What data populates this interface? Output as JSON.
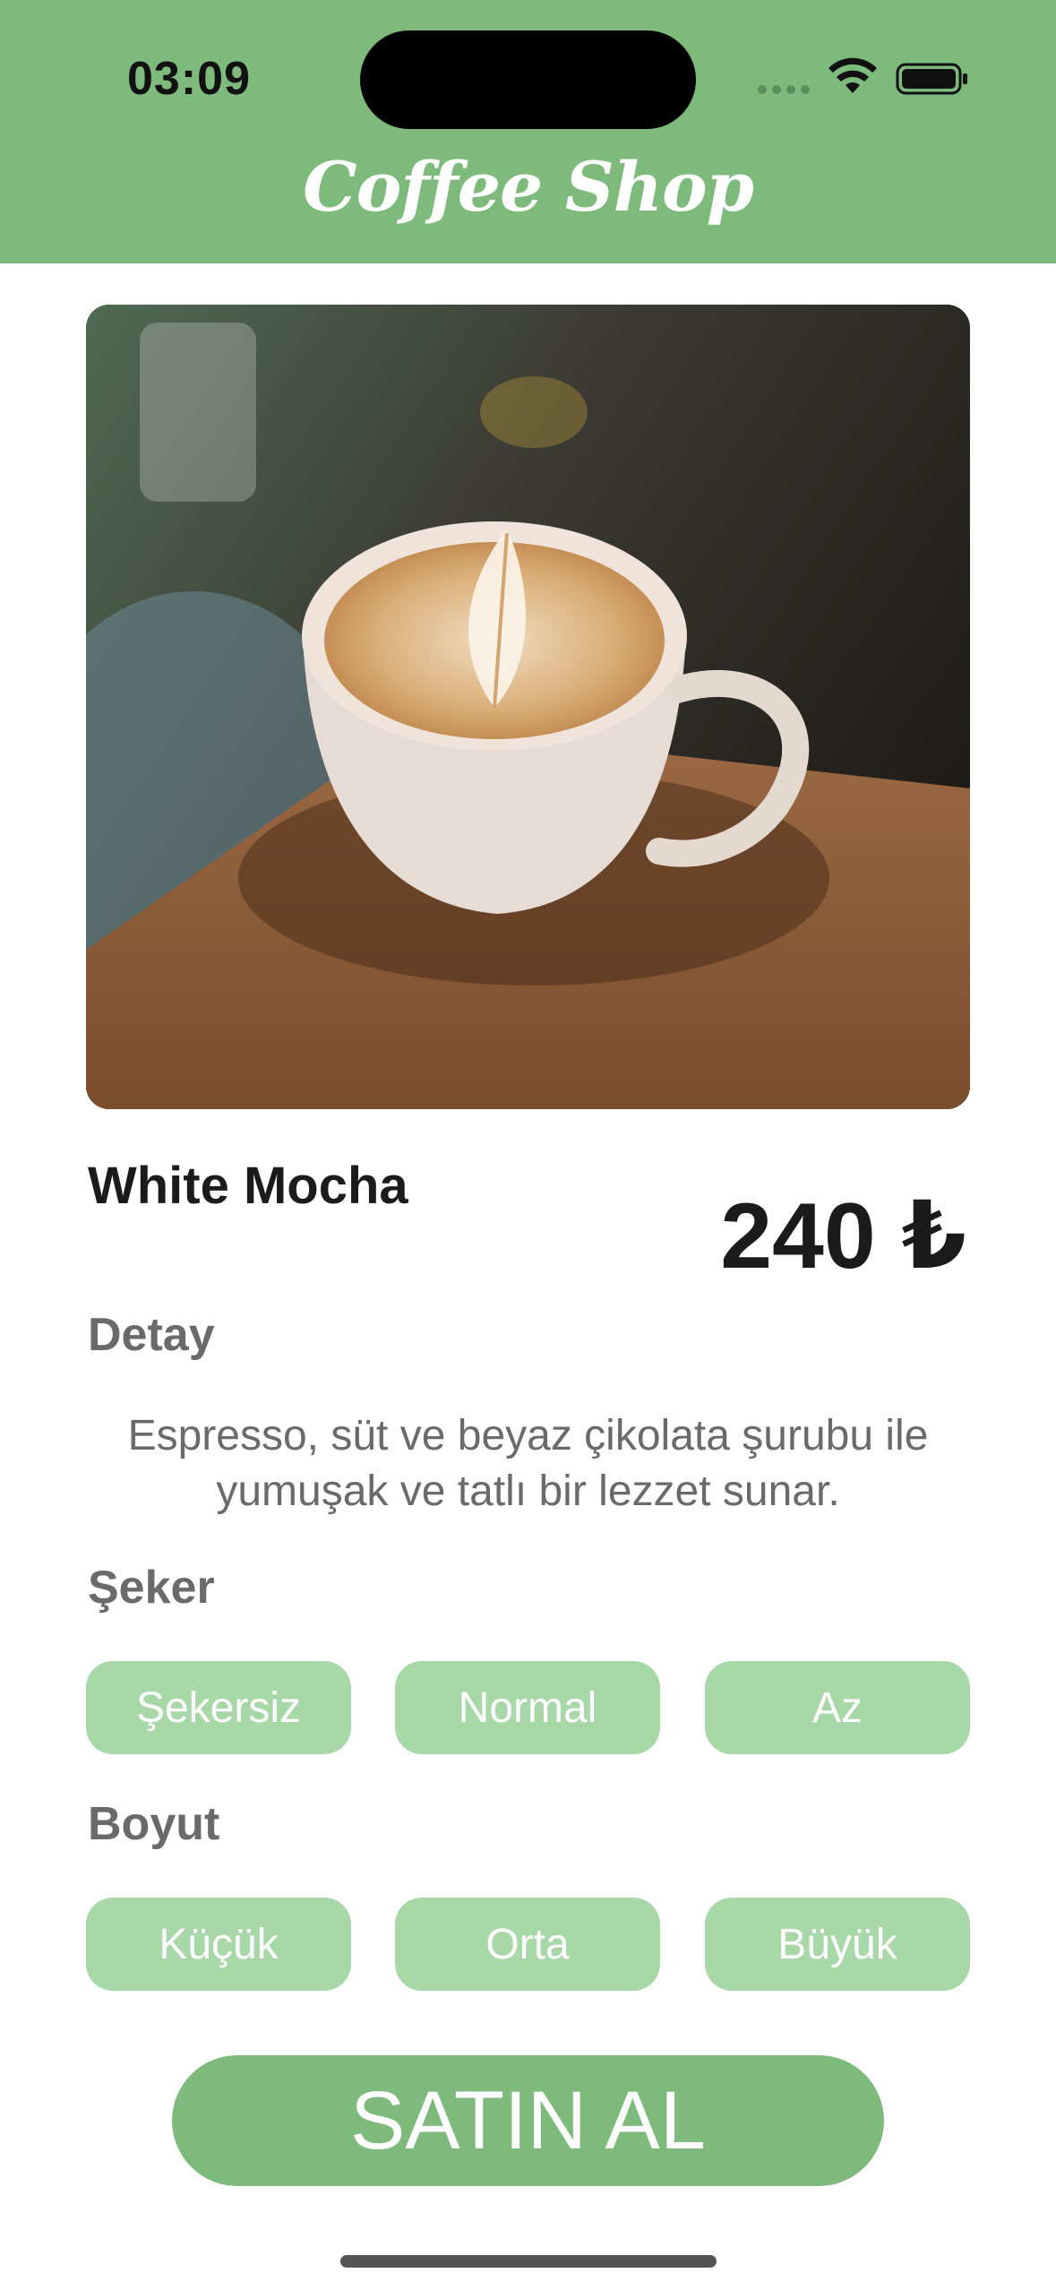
{
  "status_bar": {
    "time": "03:09"
  },
  "header": {
    "title": "Coffee Shop",
    "background": "#7dba7b"
  },
  "product": {
    "name": "White Mocha",
    "price": "240 ₺",
    "image": "latte-art-cup-photo"
  },
  "detail": {
    "label": "Detay",
    "text": "Espresso, süt ve beyaz çikolata şurubu ile yumuşak ve tatlı bir lezzet sunar."
  },
  "sugar": {
    "label": "Şeker",
    "options": [
      "Şekersiz",
      "Normal",
      "Az"
    ]
  },
  "size": {
    "label": "Boyut",
    "options": [
      "Küçük",
      "Orta",
      "Büyük"
    ]
  },
  "buy_button": {
    "label": "SATIN AL"
  },
  "colors": {
    "accent": "#7dba7b",
    "chip": "#a8d8a7",
    "text": "#1b1b1b",
    "muted": "#6a6a6a"
  }
}
